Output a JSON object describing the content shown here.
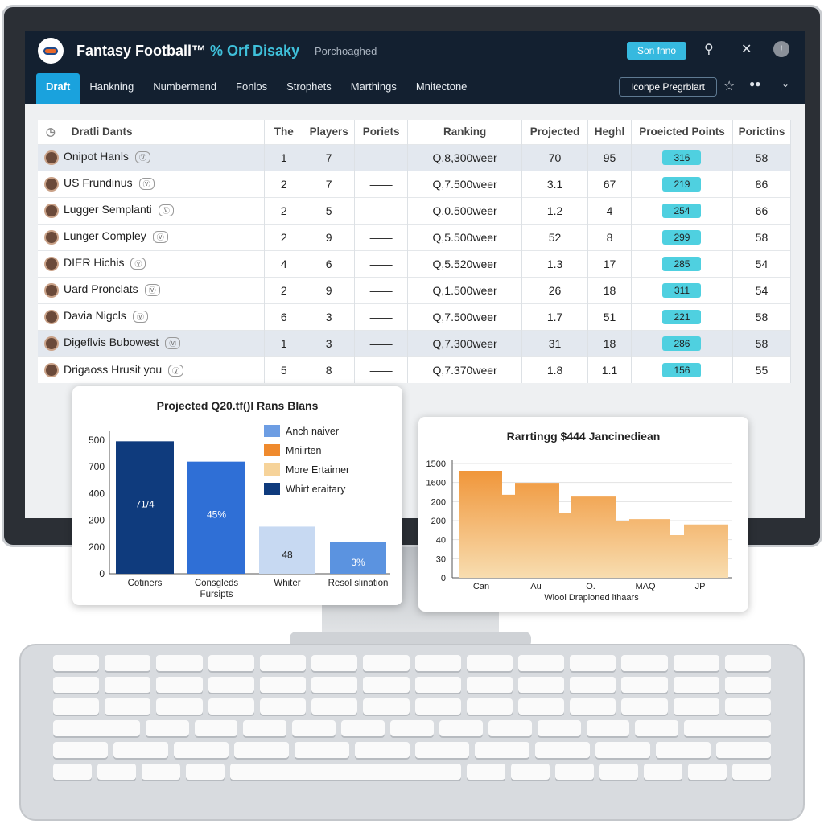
{
  "header": {
    "app_title": "Fantasy Football™",
    "title_accent": "% Orf Disaky",
    "subtitle": "Porchoaghed",
    "signin_label": "Son fnno",
    "page_button": "Iconpe Pregrblart"
  },
  "nav": {
    "tabs": [
      "Draft",
      "Hankning",
      "Numbermend",
      "Fonlos",
      "Strophets",
      "Marthings",
      "Mnitectone"
    ],
    "active": "Draft"
  },
  "table": {
    "columns": [
      "Dratli Dants",
      "The",
      "Players",
      "Poriets",
      "Ranking",
      "Projected",
      "Heghl",
      "Proeicted Points",
      "Porictins"
    ],
    "rows": [
      [
        "Onipot Hanls",
        "1",
        "7",
        "——",
        "Q,8,300weer",
        "70",
        "95",
        "316",
        "58"
      ],
      [
        "US Frundinus",
        "2",
        "7",
        "——",
        "Q,7.500weer",
        "3.1",
        "67",
        "219",
        "86"
      ],
      [
        "Lugger Semplanti",
        "2",
        "5",
        "——",
        "Q,0.500weer",
        "1.2",
        "4",
        "254",
        "66"
      ],
      [
        "Lunger Compley",
        "2",
        "9",
        "——",
        "Q,5.500weer",
        "52",
        "8",
        "299",
        "58"
      ],
      [
        "DIER Hichis",
        "4",
        "6",
        "——",
        "Q,5.520weer",
        "1.3",
        "17",
        "285",
        "54"
      ],
      [
        "Uard Pronclats",
        "2",
        "9",
        "——",
        "Q,1.500weer",
        "26",
        "18",
        "311",
        "54"
      ],
      [
        "Davia Nigcls",
        "6",
        "3",
        "——",
        "Q,7.500weer",
        "1.7",
        "51",
        "221",
        "58"
      ],
      [
        "Digeflvis Bubowest",
        "1",
        "3",
        "——",
        "Q,7.300weer",
        "31",
        "18",
        "286",
        "58"
      ],
      [
        "Drigaoss Hrusit you",
        "5",
        "8",
        "——",
        "Q,7.370weer",
        "1.8",
        "1.1",
        "156",
        "55"
      ]
    ],
    "highlighted_rows": [
      0,
      7
    ],
    "pill_color": "#4fd0e0"
  },
  "chart_data": [
    {
      "type": "bar",
      "title": "Projected Q20.tf()I Rans Blans",
      "categories": [
        "Cotiners",
        "Consgleds Fursipts",
        "Whiter",
        "Resol slination"
      ],
      "values": [
        520,
        440,
        185,
        125
      ],
      "data_labels": [
        "71/4",
        "45%",
        "48",
        "3%"
      ],
      "colors": [
        "#0f3b7d",
        "#2f6fd6",
        "#c7d9f2",
        "#5b93e0"
      ],
      "yticks": [
        "0",
        "200",
        "200",
        "400",
        "700",
        "500"
      ],
      "legend": [
        {
          "label": "Anch naiver",
          "color": "#6d9de3"
        },
        {
          "label": "Mniirten",
          "color": "#ef8a2e"
        },
        {
          "label": "More Ertaimer",
          "color": "#f6d39a"
        },
        {
          "label": "Whirt eraitary",
          "color": "#0f3b7d"
        }
      ],
      "legend_position": "top-right"
    },
    {
      "type": "area",
      "title": "Rarrtingg $444 Jancinediean",
      "xlabel": "Wlool Draploned lthaars",
      "xticks": [
        "Can",
        "Au",
        "O.",
        "MAQ",
        "JP"
      ],
      "yticks": [
        "0",
        "30",
        "40",
        "200",
        "200",
        "1600",
        "1500"
      ],
      "ylim": [
        0,
        1500
      ],
      "values": [
        1405,
        1090,
        1245,
        855,
        1065,
        740,
        770,
        560,
        700
      ],
      "color": "#f0a040",
      "grid": true
    }
  ]
}
